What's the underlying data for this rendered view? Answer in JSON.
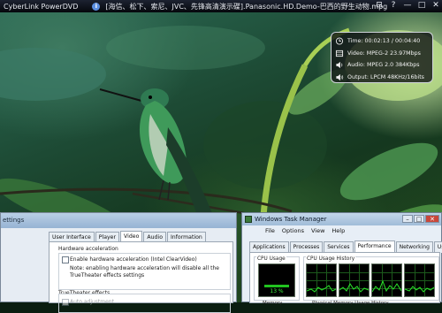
{
  "player": {
    "app_title": "CyberLink PowerDVD",
    "file_title": "[海信、松下、索尼、JVC、先锋高清演示碟].Panasonic.HD.Demo-巴西的野生动物.mpg",
    "window_buttons": [
      "⊟",
      "?",
      "—",
      "□",
      "✕"
    ]
  },
  "stats": {
    "time": "Time: 00:02:13 / 00:04:40",
    "video": "Video: MPEG-2  23.97Mbps",
    "audio": "Audio: MPEG 2.0   384Kbps",
    "output": "Output: LPCM 48KHz/16bits"
  },
  "settings": {
    "title": "ettings",
    "tabs": [
      "User Interface",
      "Player",
      "Video",
      "Audio",
      "Information"
    ],
    "active_tab": "Video",
    "hw_group": "Hardware acceleration",
    "hw_checkbox": "Enable hardware acceleration (Intel ClearVideo)",
    "hw_note_1": "Note: enabling hardware acceleration will disable all the",
    "hw_note_2": "TrueTheater effects settings",
    "tt_group": "TrueTheater effects",
    "tt_item": "Auto adjustment"
  },
  "taskmgr": {
    "title": "Windows Task Manager",
    "menu": [
      "File",
      "Options",
      "View",
      "Help"
    ],
    "tabs": [
      "Applications",
      "Processes",
      "Services",
      "Performance",
      "Networking",
      "Users"
    ],
    "active_tab": "Performance",
    "cpu_usage_label": "CPU Usage",
    "cpu_history_label": "CPU Usage History",
    "cpu_percent": "13 %",
    "cpu_value": 13,
    "memory_label": "Memory",
    "phys_mem_label": "Physical Memory Usage History"
  }
}
